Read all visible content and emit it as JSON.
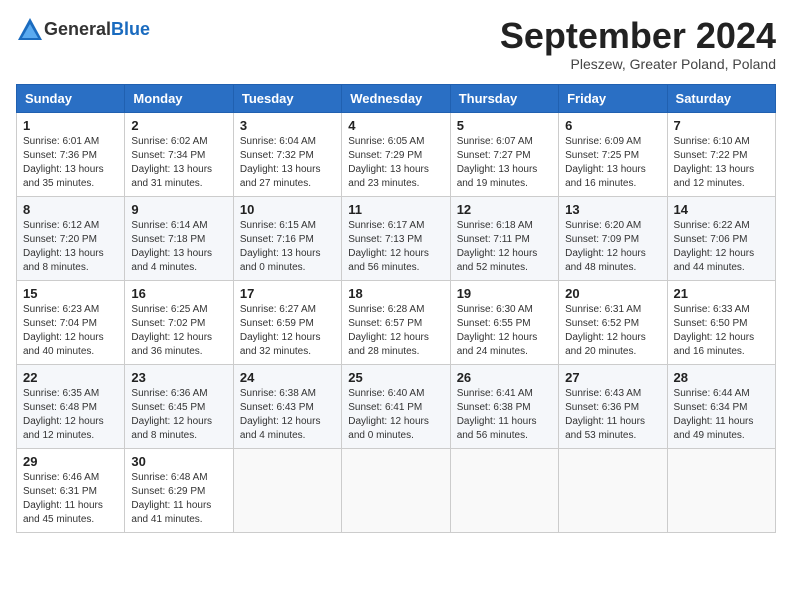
{
  "header": {
    "logo_general": "General",
    "logo_blue": "Blue",
    "title": "September 2024",
    "subtitle": "Pleszew, Greater Poland, Poland"
  },
  "weekdays": [
    "Sunday",
    "Monday",
    "Tuesday",
    "Wednesday",
    "Thursday",
    "Friday",
    "Saturday"
  ],
  "weeks": [
    [
      {
        "day": "1",
        "sunrise": "6:01 AM",
        "sunset": "7:36 PM",
        "daylight": "13 hours and 35 minutes."
      },
      {
        "day": "2",
        "sunrise": "6:02 AM",
        "sunset": "7:34 PM",
        "daylight": "13 hours and 31 minutes."
      },
      {
        "day": "3",
        "sunrise": "6:04 AM",
        "sunset": "7:32 PM",
        "daylight": "13 hours and 27 minutes."
      },
      {
        "day": "4",
        "sunrise": "6:05 AM",
        "sunset": "7:29 PM",
        "daylight": "13 hours and 23 minutes."
      },
      {
        "day": "5",
        "sunrise": "6:07 AM",
        "sunset": "7:27 PM",
        "daylight": "13 hours and 19 minutes."
      },
      {
        "day": "6",
        "sunrise": "6:09 AM",
        "sunset": "7:25 PM",
        "daylight": "13 hours and 16 minutes."
      },
      {
        "day": "7",
        "sunrise": "6:10 AM",
        "sunset": "7:22 PM",
        "daylight": "13 hours and 12 minutes."
      }
    ],
    [
      {
        "day": "8",
        "sunrise": "6:12 AM",
        "sunset": "7:20 PM",
        "daylight": "13 hours and 8 minutes."
      },
      {
        "day": "9",
        "sunrise": "6:14 AM",
        "sunset": "7:18 PM",
        "daylight": "13 hours and 4 minutes."
      },
      {
        "day": "10",
        "sunrise": "6:15 AM",
        "sunset": "7:16 PM",
        "daylight": "13 hours and 0 minutes."
      },
      {
        "day": "11",
        "sunrise": "6:17 AM",
        "sunset": "7:13 PM",
        "daylight": "12 hours and 56 minutes."
      },
      {
        "day": "12",
        "sunrise": "6:18 AM",
        "sunset": "7:11 PM",
        "daylight": "12 hours and 52 minutes."
      },
      {
        "day": "13",
        "sunrise": "6:20 AM",
        "sunset": "7:09 PM",
        "daylight": "12 hours and 48 minutes."
      },
      {
        "day": "14",
        "sunrise": "6:22 AM",
        "sunset": "7:06 PM",
        "daylight": "12 hours and 44 minutes."
      }
    ],
    [
      {
        "day": "15",
        "sunrise": "6:23 AM",
        "sunset": "7:04 PM",
        "daylight": "12 hours and 40 minutes."
      },
      {
        "day": "16",
        "sunrise": "6:25 AM",
        "sunset": "7:02 PM",
        "daylight": "12 hours and 36 minutes."
      },
      {
        "day": "17",
        "sunrise": "6:27 AM",
        "sunset": "6:59 PM",
        "daylight": "12 hours and 32 minutes."
      },
      {
        "day": "18",
        "sunrise": "6:28 AM",
        "sunset": "6:57 PM",
        "daylight": "12 hours and 28 minutes."
      },
      {
        "day": "19",
        "sunrise": "6:30 AM",
        "sunset": "6:55 PM",
        "daylight": "12 hours and 24 minutes."
      },
      {
        "day": "20",
        "sunrise": "6:31 AM",
        "sunset": "6:52 PM",
        "daylight": "12 hours and 20 minutes."
      },
      {
        "day": "21",
        "sunrise": "6:33 AM",
        "sunset": "6:50 PM",
        "daylight": "12 hours and 16 minutes."
      }
    ],
    [
      {
        "day": "22",
        "sunrise": "6:35 AM",
        "sunset": "6:48 PM",
        "daylight": "12 hours and 12 minutes."
      },
      {
        "day": "23",
        "sunrise": "6:36 AM",
        "sunset": "6:45 PM",
        "daylight": "12 hours and 8 minutes."
      },
      {
        "day": "24",
        "sunrise": "6:38 AM",
        "sunset": "6:43 PM",
        "daylight": "12 hours and 4 minutes."
      },
      {
        "day": "25",
        "sunrise": "6:40 AM",
        "sunset": "6:41 PM",
        "daylight": "12 hours and 0 minutes."
      },
      {
        "day": "26",
        "sunrise": "6:41 AM",
        "sunset": "6:38 PM",
        "daylight": "11 hours and 56 minutes."
      },
      {
        "day": "27",
        "sunrise": "6:43 AM",
        "sunset": "6:36 PM",
        "daylight": "11 hours and 53 minutes."
      },
      {
        "day": "28",
        "sunrise": "6:44 AM",
        "sunset": "6:34 PM",
        "daylight": "11 hours and 49 minutes."
      }
    ],
    [
      {
        "day": "29",
        "sunrise": "6:46 AM",
        "sunset": "6:31 PM",
        "daylight": "11 hours and 45 minutes."
      },
      {
        "day": "30",
        "sunrise": "6:48 AM",
        "sunset": "6:29 PM",
        "daylight": "11 hours and 41 minutes."
      },
      null,
      null,
      null,
      null,
      null
    ]
  ]
}
